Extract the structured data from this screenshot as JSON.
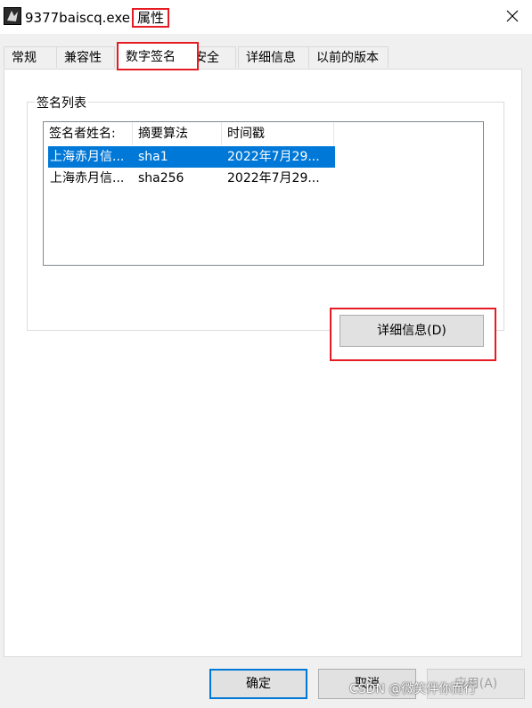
{
  "window": {
    "title_file": "9377baiscq.exe",
    "title_suffix": "属性"
  },
  "tabs": [
    {
      "label": "常规"
    },
    {
      "label": "兼容性"
    },
    {
      "label": "数字签名"
    },
    {
      "label": "安全"
    },
    {
      "label": "详细信息"
    },
    {
      "label": "以前的版本"
    }
  ],
  "signature_group": {
    "legend": "签名列表",
    "columns": [
      "签名者姓名:",
      "摘要算法",
      "时间戳"
    ],
    "rows": [
      {
        "signer": "上海赤月信...",
        "digest": "sha1",
        "timestamp": "2022年7月29..."
      },
      {
        "signer": "上海赤月信...",
        "digest": "sha256",
        "timestamp": "2022年7月29..."
      }
    ],
    "details_button": "详细信息(D)"
  },
  "footer": {
    "ok": "确定",
    "cancel": "取消",
    "apply": "应用(A)"
  },
  "watermark": "CSDN @微笑伴你而行",
  "colors": {
    "selection": "#0078d7",
    "highlight_box": "#e51c23"
  }
}
